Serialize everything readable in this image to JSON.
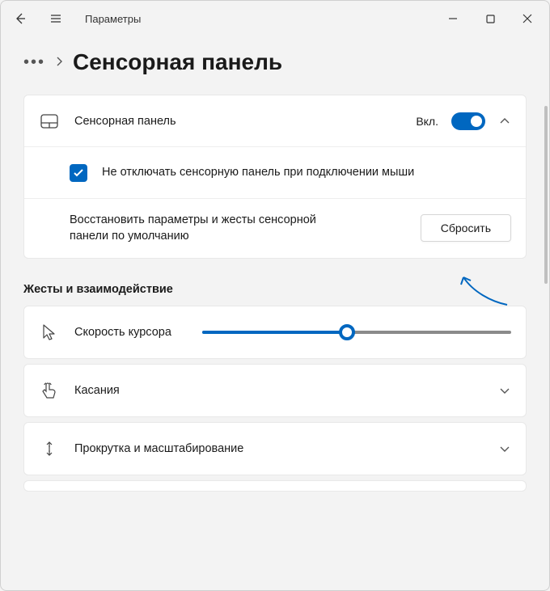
{
  "colors": {
    "accent": "#0067c0"
  },
  "titlebar": {
    "app_title": "Параметры"
  },
  "breadcrumb": {
    "page_title": "Сенсорная панель"
  },
  "touchpad_card": {
    "label": "Сенсорная панель",
    "state_text": "Вкл.",
    "keep_on_mouse": "Не отключать сенсорную панель при подключении мыши",
    "reset_desc": "Восстановить параметры и жесты сенсорной панели по умолчанию",
    "reset_button": "Сбросить"
  },
  "section_gestures": "Жесты и взаимодействие",
  "cursor_speed": {
    "label": "Скорость курсора",
    "value_percent": 47
  },
  "taps": {
    "label": "Касания"
  },
  "scroll_zoom": {
    "label": "Прокрутка и масштабирование"
  }
}
